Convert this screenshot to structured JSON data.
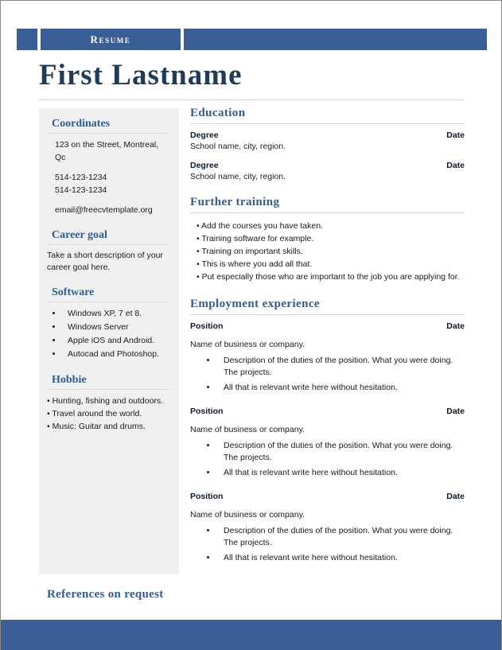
{
  "document": {
    "header_label": "Resume",
    "name": "First Lastname",
    "footer_note": "References on request"
  },
  "colors": {
    "bar_blue": "#3a5f94",
    "heading_blue": "#2f5b96",
    "name_navy": "#1f3b5c",
    "sidebar_gray": "#f0f0f0"
  },
  "sidebar": {
    "sections": [
      {
        "title": "Coordinates",
        "lines": [
          "123 on the Street, Montreal, Qc",
          "514-123-1234",
          "514-123-1234",
          "email@freecvtemplate.org"
        ]
      },
      {
        "title": "Career goal",
        "text": "Take a short description of your career goal here."
      },
      {
        "title": "Software",
        "items": [
          "Windows XP, 7 et 8.",
          "Windows Server",
          "Apple iOS and Android.",
          "Autocad and Photoshop."
        ]
      },
      {
        "title": "Hobbie",
        "items": [
          "• Hunting, fishing and outdoors.",
          "• Travel around the world.",
          "• Music: Guitar and drums."
        ]
      }
    ]
  },
  "main": {
    "education": {
      "title": "Education",
      "entries": [
        {
          "degree": "Degree",
          "date": "Date",
          "school": "School name, city, region."
        },
        {
          "degree": "Degree",
          "date": "Date",
          "school": "School name, city, region."
        }
      ]
    },
    "further_training": {
      "title": "Further training",
      "items": [
        "• Add the courses you have taken.",
        "• Training software for example.",
        "• Training on important skills.",
        "• This is where you add all that.",
        "• Put especially those who are important to the job you are applying for."
      ]
    },
    "employment": {
      "title": "Employment  experience",
      "entries": [
        {
          "position": "Position",
          "date": "Date",
          "company": "Name of business or company.",
          "duties": [
            "Description of the duties of the position. What you were doing. The projects.",
            "All that is relevant write here without hesitation."
          ]
        },
        {
          "position": "Position",
          "date": "Date",
          "company": "Name of business or company.",
          "duties": [
            "Description of the duties of the position. What you were doing. The projects.",
            "All that is relevant write here without hesitation."
          ]
        },
        {
          "position": "Position",
          "date": "Date",
          "company": "Name of business or company.",
          "duties": [
            "Description of the duties of the position. What you were doing. The projects.",
            "All that is relevant write here without hesitation."
          ]
        }
      ]
    }
  }
}
